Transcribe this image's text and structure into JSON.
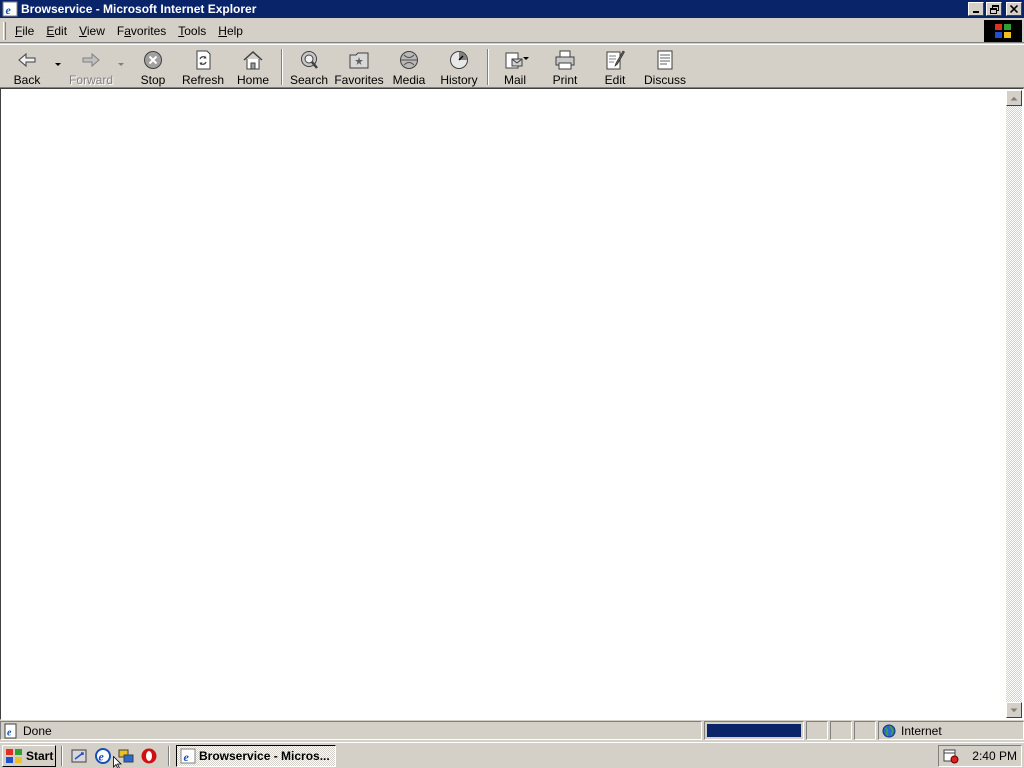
{
  "window": {
    "title": "Browservice - Microsoft Internet Explorer"
  },
  "menu": {
    "items": [
      {
        "accel": "F",
        "rest": "ile"
      },
      {
        "accel": "E",
        "rest": "dit"
      },
      {
        "accel": "V",
        "rest": "iew"
      },
      {
        "pre": "F",
        "accel": "a",
        "rest": "vorites"
      },
      {
        "accel": "T",
        "rest": "ools"
      },
      {
        "accel": "H",
        "rest": "elp"
      }
    ]
  },
  "toolbar": {
    "back": "Back",
    "forward": "Forward",
    "stop": "Stop",
    "refresh": "Refresh",
    "home": "Home",
    "search": "Search",
    "favorites": "Favorites",
    "media": "Media",
    "history": "History",
    "mail": "Mail",
    "print": "Print",
    "edit": "Edit",
    "discuss": "Discuss"
  },
  "status": {
    "text": "Done",
    "progress": 1.0,
    "zone": "Internet"
  },
  "taskbar": {
    "start_label": "Start",
    "task_label": "Browservice - Micros...",
    "clock": "2:40 PM"
  },
  "colors": {
    "title_active": "#0a246a",
    "face": "#d4d0c8",
    "progress": "#0a246a"
  }
}
